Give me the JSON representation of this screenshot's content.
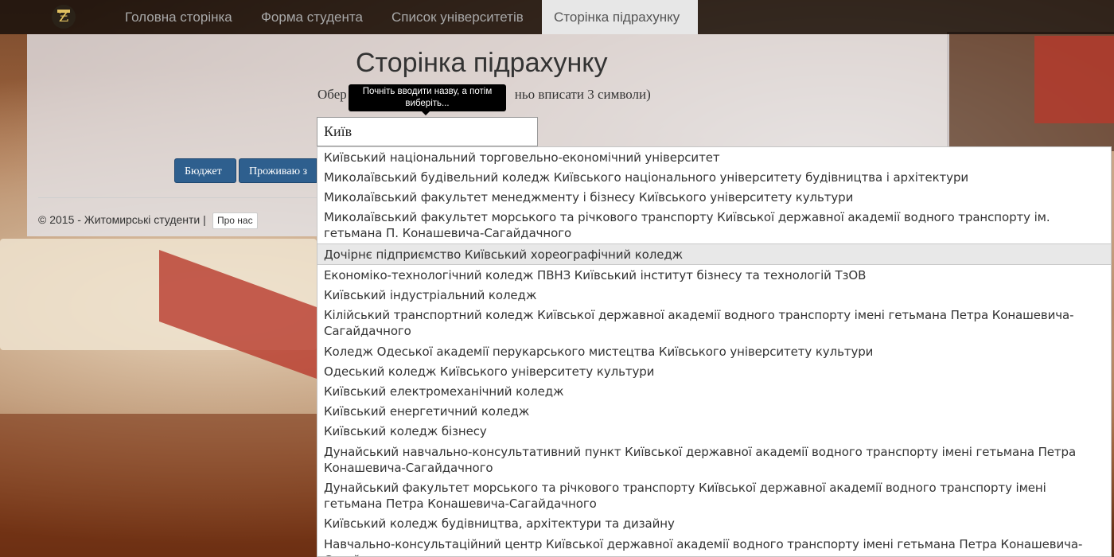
{
  "nav": {
    "items": [
      {
        "label": "Головна сторінка"
      },
      {
        "label": "Форма студента"
      },
      {
        "label": "Список університетів"
      },
      {
        "label": "Сторінка підрахунку"
      }
    ],
    "active_index": 3
  },
  "page": {
    "title": "Сторінка підрахунку",
    "instruction_visible": "Обер",
    "instruction_tail": "ньо вписати 3 символи)"
  },
  "tooltip": {
    "text": "Почніть вводити назву, а потім виберіть..."
  },
  "search": {
    "value": "Київ"
  },
  "buttons": {
    "budget": "Бюджет",
    "living": "Проживаю з"
  },
  "footer": {
    "text": "© 2015 - Житомирські студенти |",
    "about": "Про нас"
  },
  "autocomplete": {
    "highlighted_index": 4,
    "items": [
      "Київський національний торговельно-економічний університет",
      "Миколаївський будівельний коледж Київського національного університету будівництва і архітектури",
      "Миколаївський факультет менеджменту і бізнесу Київського університету культури",
      "Миколаївський факультет морського та річкового транспорту Київської державної академії водного транспорту ім. гетьмана П. Конашевича-Сагайдачного",
      "Дочірнє підприємство Київський хореографічний коледж",
      "Економіко-технологічний коледж ПВНЗ Київський інститут бізнесу та технологій ТзОВ",
      "Київський індустріальний коледж",
      "Кілійський транспортний коледж Київської державної академії водного транспорту імені гетьмана Петра Конашевича-Сагайдачного",
      "Коледж Одеської академії перукарського мистецтва Київського університету культури",
      "Одеський коледж Київського університету культури",
      "Київський електромеханічний коледж",
      "Київський енергетичний коледж",
      "Київський коледж бізнесу",
      "Дунайський навчально-консультативний пункт Київської державної академії водного транспорту імені гетьмана Петра Конашевича-Сагайдачного",
      "Дунайський факультет морського та річкового транспорту Київської державної академії водного транспорту імені гетьмана Петра Конашевича-Сагайдачного",
      "Київський коледж будівництва, архітектури та дизайну",
      "Навчально-консультаційний центр Київської державної академії водного транспорту імені гетьмана Петра Конашевича-Сагайдачного"
    ]
  }
}
